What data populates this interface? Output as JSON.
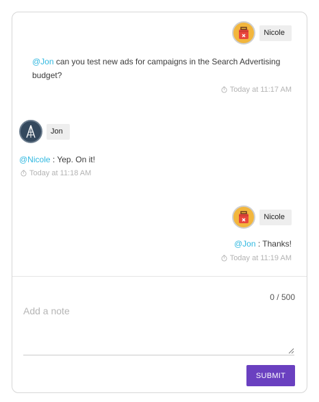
{
  "messages": [
    {
      "author": "Nicole",
      "mention": "@Jon",
      "text": " can you test new ads for campaigns in the Search Advertising budget?",
      "time": "Today at 11:17 AM"
    },
    {
      "author": "Jon",
      "mention": "@Nicole",
      "text": " : Yep. On it!",
      "time": "Today at 11:18 AM"
    },
    {
      "author": "Nicole",
      "mention": "@Jon",
      "text": " : Thanks!",
      "time": "Today at 11:19 AM"
    }
  ],
  "icons": {
    "nicole_avatar": "suitcase-avatar-icon",
    "jon_avatar": "tower-avatar-icon",
    "clock": "stopwatch-icon",
    "resize": "resize-grip-icon"
  },
  "colors": {
    "mention": "#30b8e0",
    "submit": "#6a40c0",
    "nicole_avatar_bg": "#f2b63d",
    "jon_avatar_bg": "#34495e"
  },
  "composer": {
    "counter": "0 / 500",
    "placeholder": "Add a note",
    "value": "",
    "submit_label": "SUBMIT"
  }
}
